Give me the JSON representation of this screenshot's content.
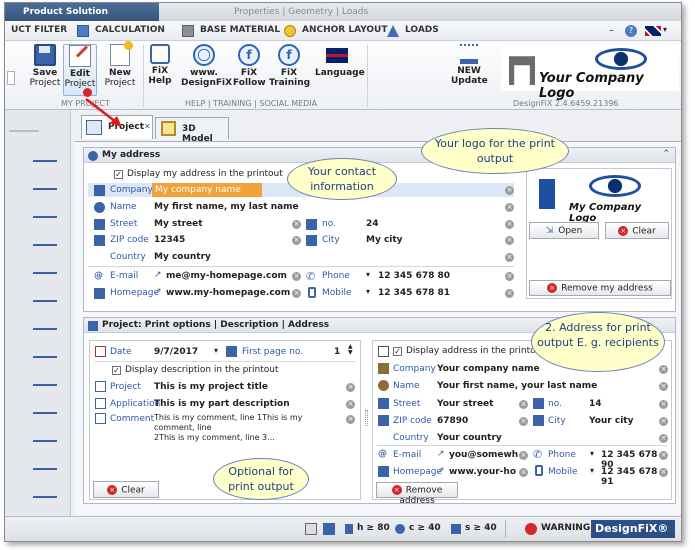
{
  "window": {
    "app_name": "Product Solution",
    "context_title": "Properties | Geometry | Loads"
  },
  "menu": {
    "tabs": [
      {
        "label": "UCT FILTER"
      },
      {
        "label": "CALCULATION"
      },
      {
        "label": "BASE MATERIAL"
      },
      {
        "label": "ANCHOR LAYOUT"
      },
      {
        "label": "LOADS"
      }
    ],
    "minimize": "–",
    "help": "?",
    "flag": "▾"
  },
  "ribbon": {
    "save": "Save",
    "save_sub": "Project",
    "edit": "Edit",
    "edit_sub": "Project",
    "new": "New",
    "new_sub": "Project",
    "fix_help": "FiX",
    "fix_help_sub": "Help",
    "web": "www.",
    "web_sub": "DesignFiX",
    "fix_follow": "FiX",
    "fix_follow_sub": "Follow",
    "fix_training": "FiX",
    "fix_training_sub": "Training",
    "language": "Language",
    "new_update": "NEW",
    "new_update_sub": "Update",
    "group_project": "MY PROJECT",
    "group_help": "HELP | TRAINING | SOCIAL MEDIA",
    "version": "DesignFiX 2.4.6459.21396",
    "logo_text": "Your Company Logo"
  },
  "doc_tabs": [
    {
      "label": "Project",
      "close": "✕"
    },
    {
      "label": "3D Model"
    }
  ],
  "address": {
    "header": "My address",
    "display_checkbox": "Display my address in the printout",
    "company_label": "Company",
    "company_value": "My company name",
    "name_label": "Name",
    "name_value": "My first name, my last name",
    "street_label": "Street",
    "street_value": "My street",
    "no_label": "no.",
    "no_value": "24",
    "zip_label": "ZIP code",
    "zip_value": "12345",
    "city_label": "City",
    "city_value": "My city",
    "country_label": "Country",
    "country_value": "My country",
    "email_label": "E-mail",
    "email_value": "me@my-homepage.com",
    "phone_label": "Phone",
    "phone_value": "12 345 678 80",
    "homepage_label": "Homepage",
    "homepage_value": "www.my-homepage.com",
    "mobile_label": "Mobile",
    "mobile_value": "12 345 678 81",
    "logo_caption": "My Company Logo",
    "open_button": "Open",
    "clear_button": "Clear",
    "remove_button": "Remove my address"
  },
  "print_options": {
    "header": "Project: Print options | Description | Address",
    "date_label": "Date",
    "date_value": "9/7/2017",
    "first_page_label": "First page no.",
    "first_page_value": "1",
    "display_description": "Display description in the printout",
    "project_label": "Project",
    "project_value": "This is my project title",
    "application_label": "Application",
    "application_value": "This is my part description",
    "comment_label": "Comment",
    "comment_line1": "This is my comment, line 1This is my comment, line",
    "comment_line2": "2This is my comment, line 3...",
    "clear_button": "Clear"
  },
  "recipient": {
    "display_checkbox": "Display address in the printout",
    "company_label": "Company",
    "company_value": "Your company name",
    "name_label": "Name",
    "name_value": "Your first name, your last name",
    "street_label": "Street",
    "street_value": "Your street",
    "no_label": "no.",
    "no_value": "14",
    "zip_label": "ZIP code",
    "zip_value": "67890",
    "city_label": "City",
    "city_value": "Your city",
    "country_label": "Country",
    "country_value": "Your country",
    "email_label": "E-mail",
    "email_value": "you@somewh",
    "phone_label": "Phone",
    "phone_value": "12 345 678 90",
    "homepage_label": "Homepage",
    "homepage_value": "www.your-ho",
    "mobile_label": "Mobile",
    "mobile_value": "12 345 678 91",
    "remove_button": "Remove address"
  },
  "callouts": {
    "contact": "Your contact information",
    "logo": "Your logo for the print output",
    "address": "2. Address for print output E. g. recipients",
    "optional": "Optional for print output"
  },
  "status": {
    "h": "h ≥ 80",
    "c": "c ≥ 40",
    "s": "s ≥ 40",
    "warning": "WARNING",
    "brand": "DesignFiX®"
  },
  "colors": {
    "accent": "#2b5aa7",
    "highlight": "#f2a23a",
    "warning_red": "#d4262b"
  }
}
